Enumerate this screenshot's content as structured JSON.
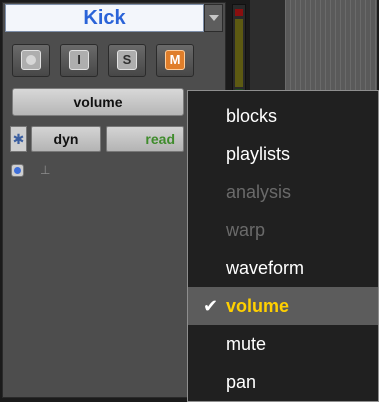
{
  "track": {
    "name": "Kick",
    "buttons": {
      "record": "",
      "input": "I",
      "solo": "S",
      "mute": "M"
    },
    "view_selector": "volume",
    "automation": {
      "symbol": "✱",
      "dyn": "dyn",
      "mode": "read"
    },
    "marker": "⊥"
  },
  "menu": {
    "items": [
      {
        "label": "blocks",
        "state": "enabled"
      },
      {
        "label": "playlists",
        "state": "enabled"
      },
      {
        "label": "analysis",
        "state": "disabled"
      },
      {
        "label": "warp",
        "state": "disabled"
      },
      {
        "label": "waveform",
        "state": "enabled"
      },
      {
        "label": "volume",
        "state": "selected"
      },
      {
        "label": "mute",
        "state": "enabled"
      },
      {
        "label": "pan",
        "state": "enabled"
      }
    ],
    "checkmark": "✔"
  },
  "colors": {
    "track_name": "#2a63d8",
    "mute_orange": "#e07e2a",
    "selected_text": "#ffd000",
    "read_green": "#3f8c2c"
  }
}
